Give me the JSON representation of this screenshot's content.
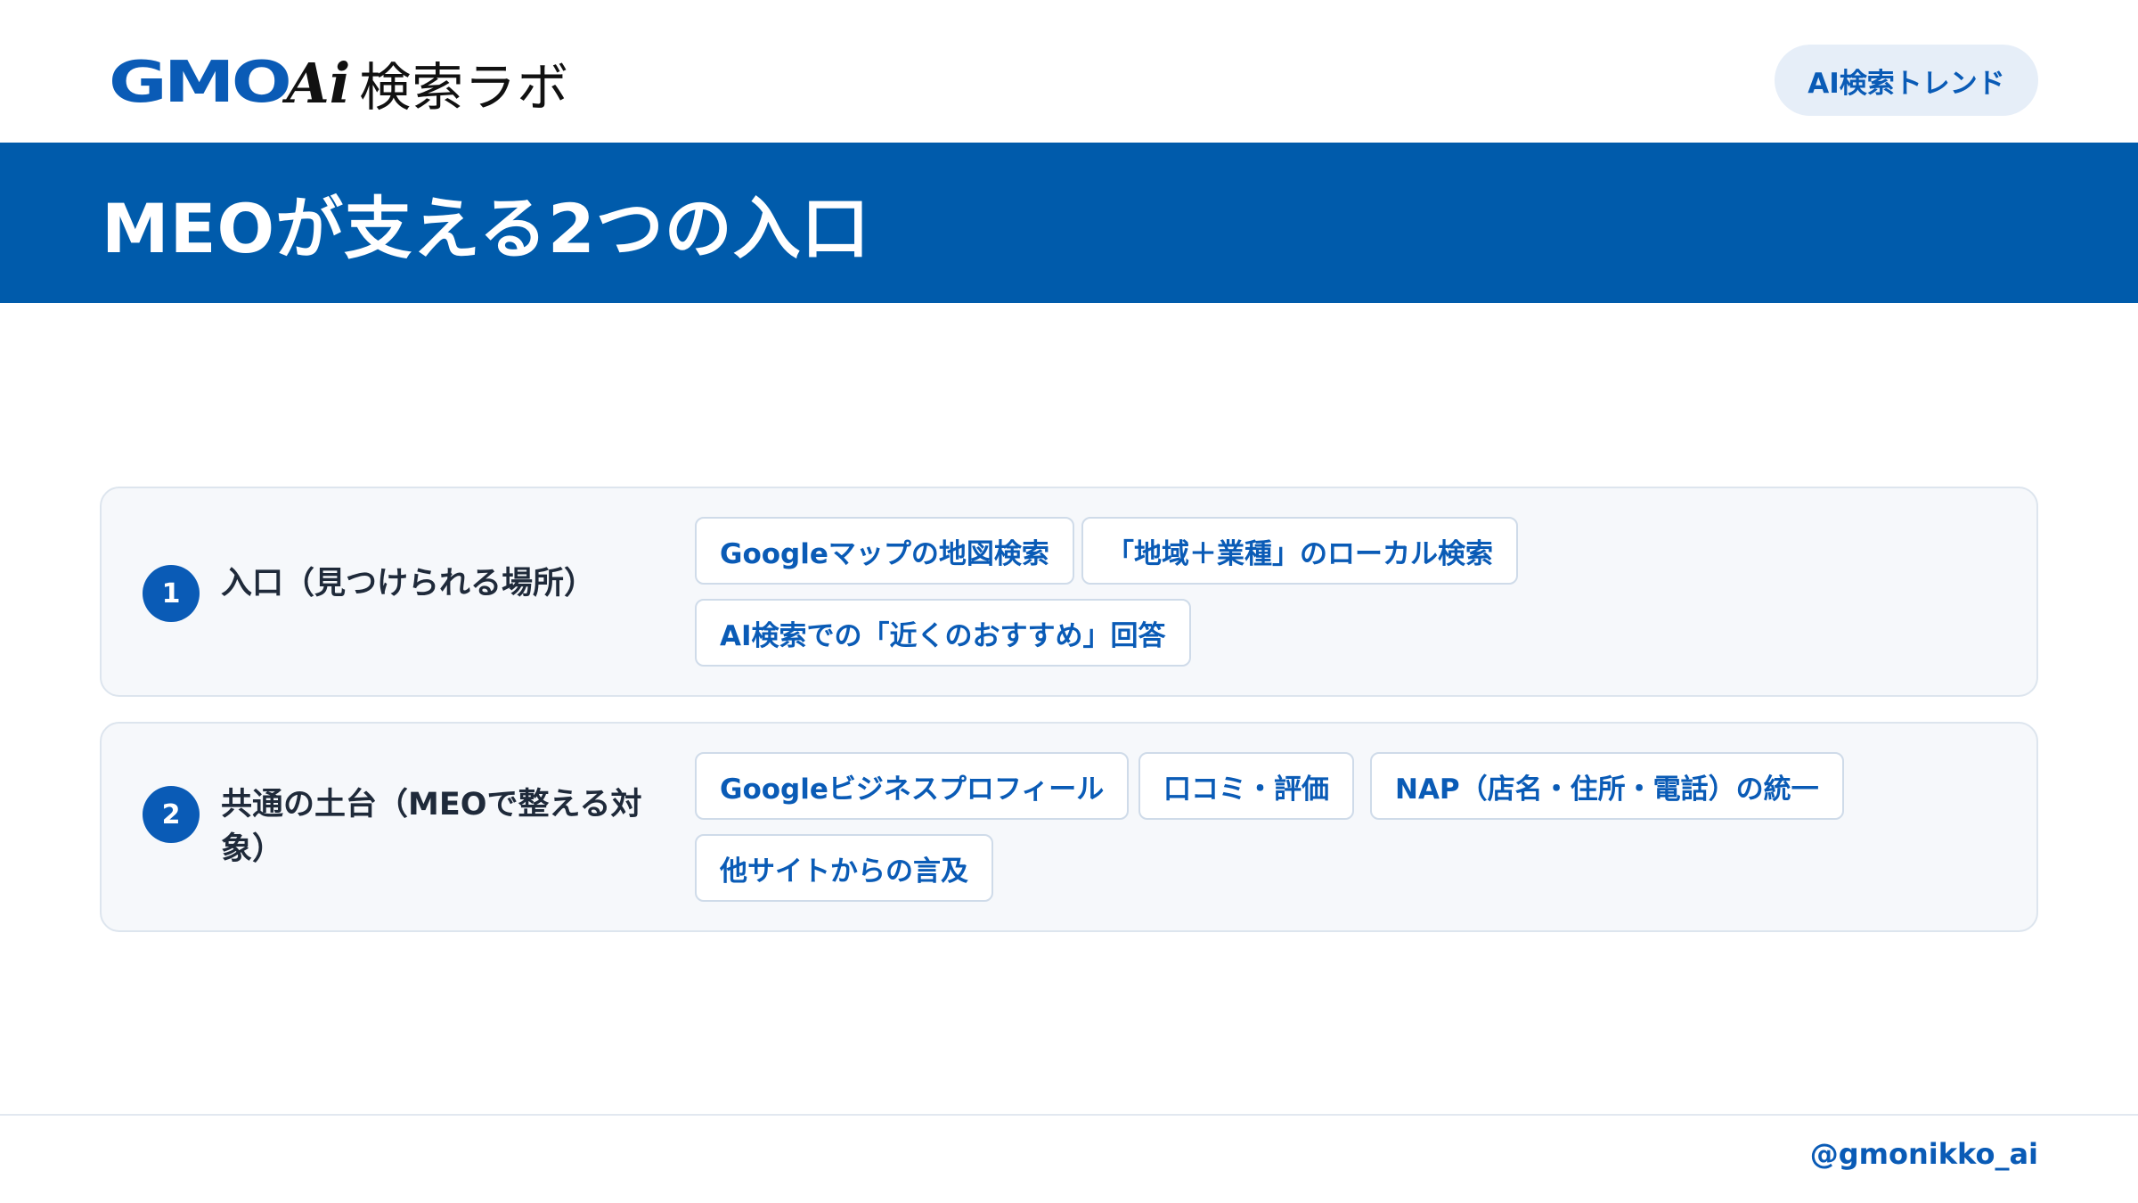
{
  "header": {
    "logo_gmo": "GMO",
    "logo_ai": "Ai",
    "logo_lab": "検索ラボ",
    "badge": "AI検索トレンド"
  },
  "title": "MEOが支える2つの入口",
  "cards": [
    {
      "number": "1",
      "label": "入口（見つけられる場所）",
      "chips": [
        "Googleマップの地図検索",
        "「地域＋業種」のローカル検索",
        "AI検索での「近くのおすすめ」回答"
      ]
    },
    {
      "number": "2",
      "label": "共通の土台（MEOで整える対象）",
      "chips": [
        "Googleビジネスプロフィール",
        "口コミ・評価",
        "NAP（店名・住所・電話）の統一",
        "他サイトからの言及"
      ]
    }
  ],
  "footer": {
    "handle": "@gmonikko_ai"
  },
  "colors": {
    "brand_blue": "#005bab",
    "text_blue": "#0a5bb6",
    "card_bg": "#f6f8fb",
    "badge_bg": "#e6eef8"
  }
}
